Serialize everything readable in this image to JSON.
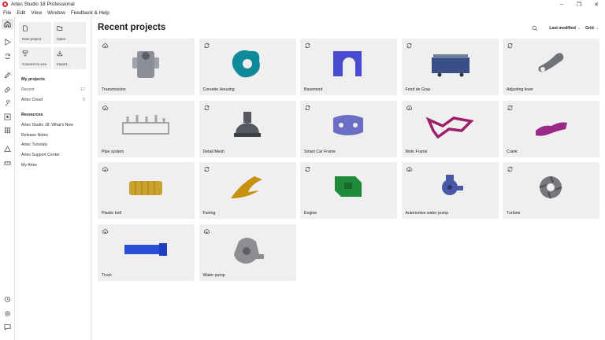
{
  "window": {
    "title": "Artec Studio 18 Professional",
    "controls": [
      "–",
      "❐",
      "✕"
    ]
  },
  "menu": [
    "File",
    "Edit",
    "View",
    "Window",
    "Feedback & Help"
  ],
  "rail_icons": [
    "home-icon",
    "play-icon",
    "refresh-scan-icon",
    "pencil-icon",
    "eraser-icon",
    "tools-icon",
    "target-icon",
    "grid-icon",
    "triangle-measure-icon",
    "ruler-icon",
    "history-icon",
    "settings-icon",
    "chat-icon"
  ],
  "quick_actions": {
    "new_project": "New project",
    "open": "Open",
    "connect_leo": "Connect to Leo",
    "import": "Import..."
  },
  "my_projects": {
    "title": "My projects",
    "recent_label": "Recent",
    "recent_count": "17",
    "cloud_label": "Artec Cloud",
    "cloud_count": "5"
  },
  "resources": {
    "title": "Resources",
    "items": [
      "Artec Studio 18: What's New",
      "Release Notes",
      "Artec Tutorials",
      "Artec Support Center",
      "My Artec"
    ]
  },
  "main": {
    "title": "Recent projects",
    "sort_label": "Last modified",
    "view_label": "Grid"
  },
  "projects": [
    {
      "name": "Transmission",
      "status": "cloud",
      "color": "#8a8f98"
    },
    {
      "name": "Corvette Housing",
      "status": "sync",
      "color": "#0f8a9a"
    },
    {
      "name": "Basement",
      "status": "sync",
      "color": "#4a4ccf"
    },
    {
      "name": "Fond de Gras",
      "status": "sync",
      "color": "#3a4f88"
    },
    {
      "name": "Adjusting lever",
      "status": "sync",
      "color": "#6f7278"
    },
    {
      "name": "Pipe system",
      "status": "cloud",
      "color": "#a3a3a3"
    },
    {
      "name": "Detail Mesh",
      "status": "sync",
      "color": "#555a60"
    },
    {
      "name": "Smart Car Frame",
      "status": "sync",
      "color": "#6a6ec4"
    },
    {
      "name": "Moto Frame",
      "status": "cloud",
      "color": "#9b1f6a"
    },
    {
      "name": "Crank",
      "status": "sync",
      "color": "#9a2a85"
    },
    {
      "name": "Plastic bolt",
      "status": "cloud",
      "color": "#c9a22e"
    },
    {
      "name": "Fairing",
      "status": "sync",
      "color": "#c6910f"
    },
    {
      "name": "Engine",
      "status": "sync",
      "color": "#1f8a3a"
    },
    {
      "name": "Automotive water pump",
      "status": "cloud",
      "color": "#4a58a8"
    },
    {
      "name": "Turbine",
      "status": "sync",
      "color": "#76787c"
    },
    {
      "name": "Truck",
      "status": "cloud",
      "color": "#2a4fd6"
    },
    {
      "name": "Water pump",
      "status": "cloud",
      "color": "#8c8e92"
    }
  ]
}
